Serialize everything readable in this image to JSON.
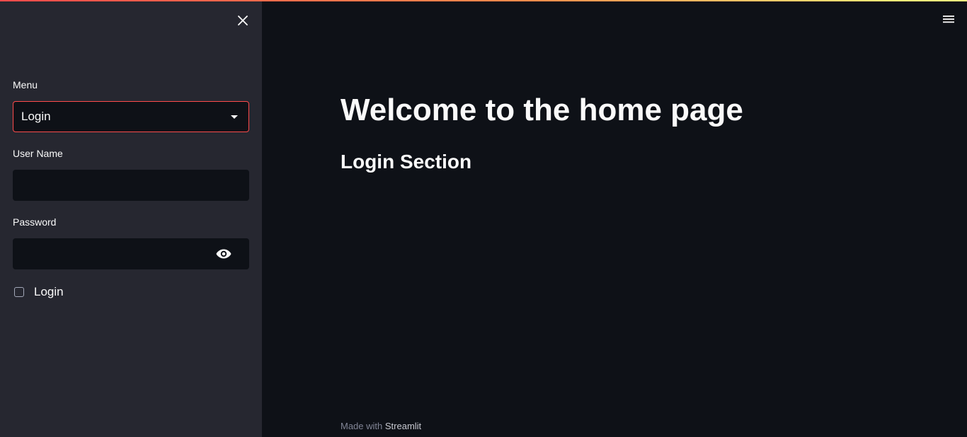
{
  "colors": {
    "primary": "#ff4b4b",
    "background": "#0e1117",
    "sidebar_background": "#262730",
    "text": "#fafafa"
  },
  "sidebar": {
    "close_icon": "close-icon",
    "menu": {
      "label": "Menu",
      "selected": "Login"
    },
    "username": {
      "label": "User Name",
      "value": ""
    },
    "password": {
      "label": "Password",
      "value": "",
      "toggle_icon": "eye-icon"
    },
    "login_checkbox": {
      "label": "Login",
      "checked": false
    }
  },
  "header": {
    "menu_icon": "hamburger-menu-icon"
  },
  "main": {
    "title": "Welcome to the home page",
    "subheader": "Login Section"
  },
  "footer": {
    "prefix": "Made with",
    "brand": "Streamlit"
  }
}
